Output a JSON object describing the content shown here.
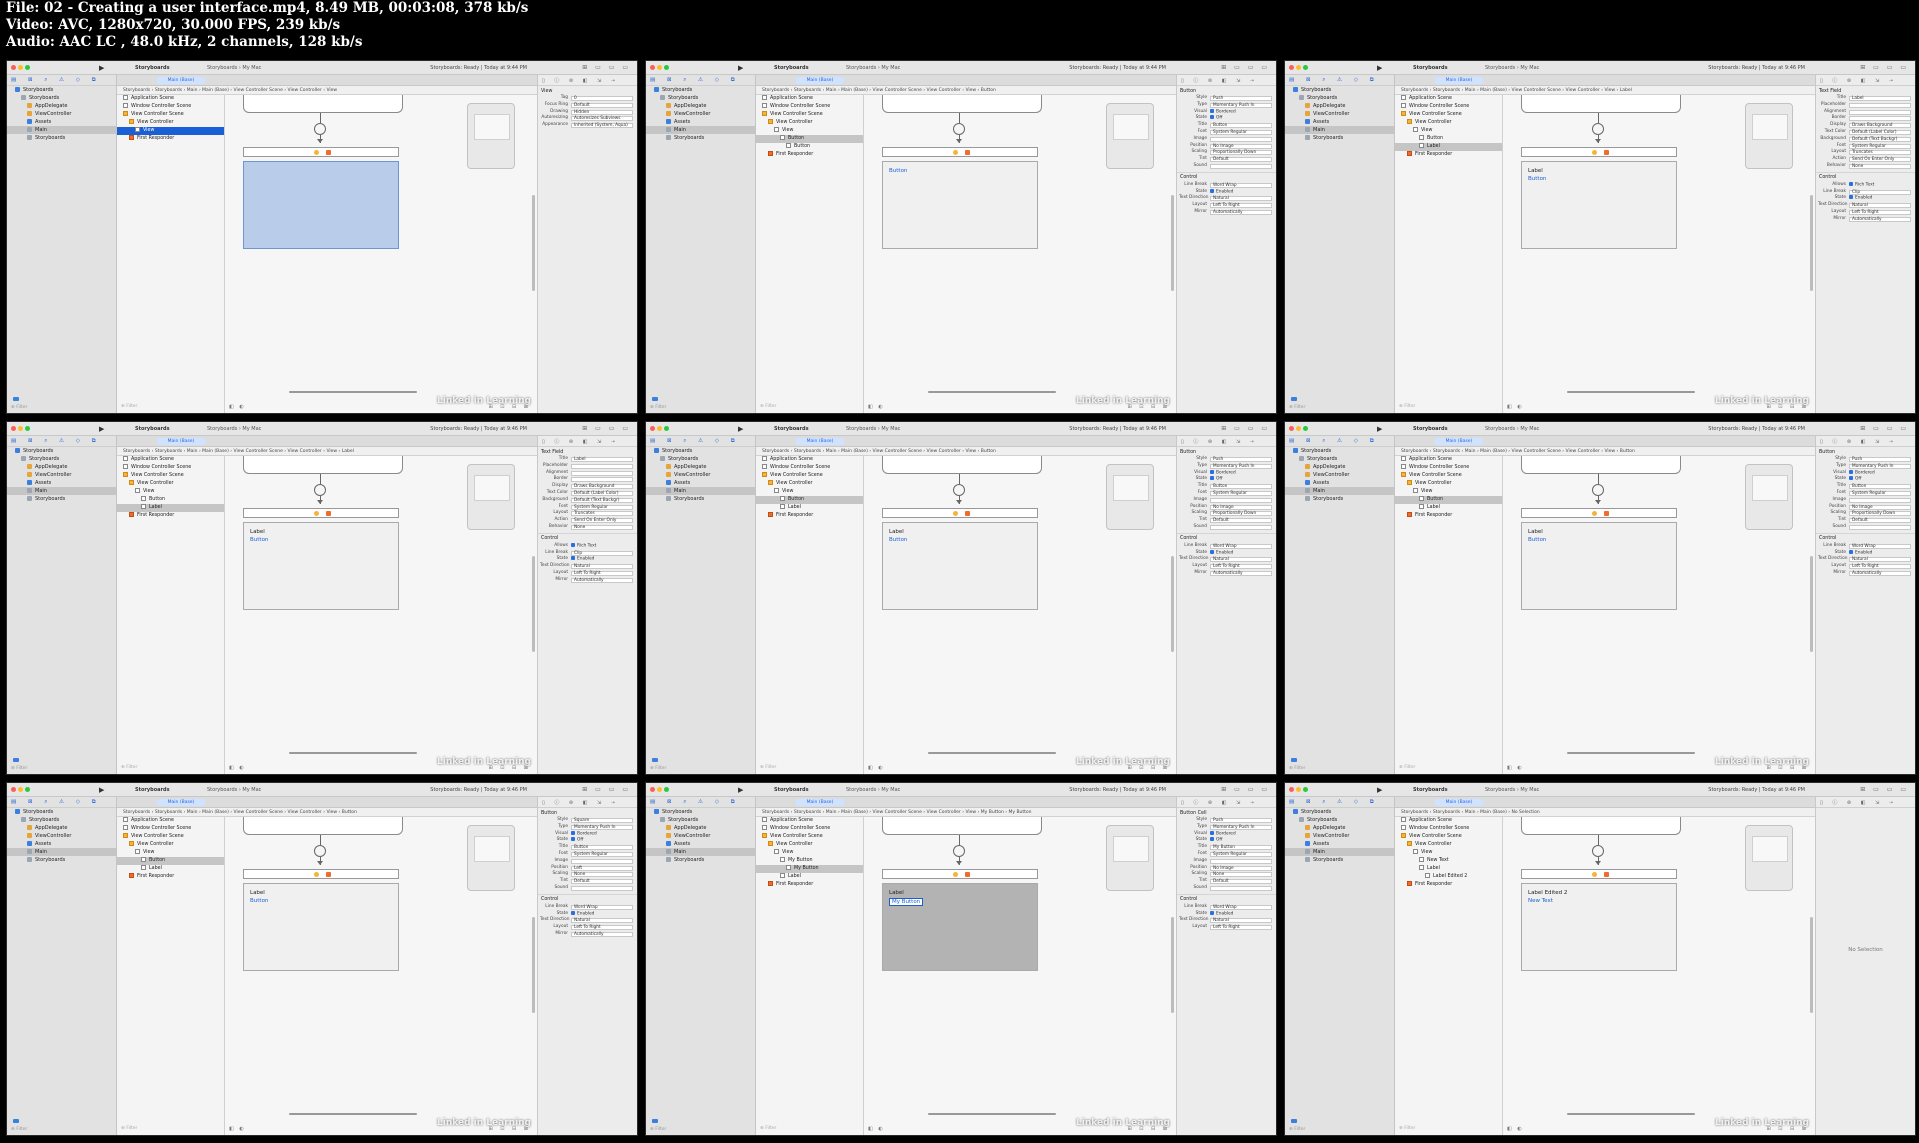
{
  "header": {
    "line1": "File: 02 - Creating a user interface.mp4, 8.49 MB, 00:03:08, 378 kb/s",
    "line2": "Video: AVC, 1280x720, 30.000 FPS, 239 kb/s",
    "line3": "Audio: AAC LC , 48.0 kHz, 2 channels, 128 kb/s"
  },
  "watermark": "Linked in Learning",
  "frames": [
    {
      "status": "Storyboards: Ready | Today at 9:44 PM",
      "jump": "Storyboards  ›  Storyboards  ›  Main  ›  Main (Base)  ›  View Controller Scene  ›  View Controller  ›  View",
      "scene": {
        "mode": "blue",
        "label": "",
        "button": ""
      },
      "inspector": {
        "title": "View",
        "rows": [
          [
            "Tag",
            "0"
          ],
          [
            "Focus Ring",
            "Default"
          ],
          [
            "Drawing",
            "Hidden"
          ],
          [
            "Autoresizing",
            "Autoresizes Subviews"
          ],
          [
            "Appearance",
            "Inherited (System, Aqua)"
          ]
        ]
      },
      "outline": [
        [
          "Application Scene",
          0,
          "sq",
          false
        ],
        [
          "Window Controller Scene",
          0,
          "sq",
          false
        ],
        [
          "View Controller Scene",
          0,
          "y",
          false
        ],
        [
          "View Controller",
          1,
          "y",
          false
        ],
        [
          "View",
          2,
          "sq",
          true
        ],
        [
          "First Responder",
          1,
          "o",
          false
        ]
      ]
    },
    {
      "status": "Storyboards: Ready | Today at 9:44 PM",
      "jump": "Storyboards  ›  Storyboards  ›  Main  ›  Main (Base)  ›  View Controller Scene  ›  View Controller  ›  View  ›  Button",
      "scene": {
        "mode": "plain",
        "label": "",
        "button": "Button"
      },
      "inspector": {
        "title": "Button",
        "rows": [
          [
            "Style",
            "Push"
          ],
          [
            "Type",
            "Momentary Push In"
          ],
          [
            "Visual",
            "Bordered"
          ],
          [
            "State",
            "Off"
          ],
          [
            "Title",
            "Button"
          ],
          [
            "Font",
            "System Regular"
          ],
          [
            "Image",
            ""
          ],
          [
            "Position",
            "No Image"
          ],
          [
            "Scaling",
            "Proportionally Down"
          ],
          [
            "Tint",
            "Default"
          ],
          [
            "Sound",
            ""
          ],
          [
            "Line Break",
            "Word Wrap"
          ],
          [
            "State",
            "Enabled"
          ],
          [
            "Text Direction",
            "Natural"
          ],
          [
            "Layout",
            "Left To Right"
          ],
          [
            "Mirror",
            "Automatically"
          ]
        ]
      },
      "outline": [
        [
          "Application Scene",
          0,
          "sq",
          false
        ],
        [
          "Window Controller Scene",
          0,
          "sq",
          false
        ],
        [
          "View Controller Scene",
          0,
          "y",
          false
        ],
        [
          "View Controller",
          1,
          "y",
          false
        ],
        [
          "View",
          2,
          "sq",
          false
        ],
        [
          "Button",
          3,
          "sq",
          true
        ],
        [
          "Button",
          4,
          "sq",
          false
        ],
        [
          "First Responder",
          1,
          "o",
          false
        ]
      ]
    },
    {
      "status": "Storyboards: Ready | Today at 9:46 PM",
      "jump": "Storyboards  ›  Storyboards  ›  Main  ›  Main (Base)  ›  View Controller Scene  ›  View Controller  ›  View  ›  Label",
      "scene": {
        "mode": "plain",
        "label": "Label",
        "button": "Button"
      },
      "inspector": {
        "title": "Text Field",
        "rows": [
          [
            "Title",
            "Label"
          ],
          [
            "Placeholder",
            ""
          ],
          [
            "Alignment",
            ""
          ],
          [
            "Border",
            ""
          ],
          [
            "Display",
            "Draws Background"
          ],
          [
            "Text Color",
            "Default (Label Color)"
          ],
          [
            "Background",
            "Default (Text Backgr)"
          ],
          [
            "Font",
            "System Regular"
          ],
          [
            "Layout",
            "Truncates"
          ],
          [
            "Action",
            "Send On Enter Only"
          ],
          [
            "Behavior",
            "None"
          ],
          [
            "Allows",
            "Rich Text"
          ],
          [
            "Line Break",
            "Clip"
          ],
          [
            "State",
            "Enabled"
          ],
          [
            "Text Direction",
            "Natural"
          ],
          [
            "Layout",
            "Left To Right"
          ],
          [
            "Mirror",
            "Automatically"
          ]
        ]
      },
      "outline": [
        [
          "Application Scene",
          0,
          "sq",
          false
        ],
        [
          "Window Controller Scene",
          0,
          "sq",
          false
        ],
        [
          "View Controller Scene",
          0,
          "y",
          false
        ],
        [
          "View Controller",
          1,
          "y",
          false
        ],
        [
          "View",
          2,
          "sq",
          false
        ],
        [
          "Button",
          3,
          "sq",
          false
        ],
        [
          "Label",
          3,
          "sq",
          true
        ],
        [
          "First Responder",
          1,
          "o",
          false
        ]
      ]
    },
    {
      "status": "Storyboards: Ready | Today at 9:46 PM",
      "jump": "Storyboards  ›  Storyboards  ›  Main  ›  Main (Base)  ›  View Controller Scene  ›  View Controller  ›  View  ›  Label",
      "scene": {
        "mode": "plain",
        "label": "Label",
        "button": "Button"
      },
      "inspector": {
        "title": "Text Field",
        "rows": [
          [
            "Title",
            "Label"
          ],
          [
            "Placeholder",
            ""
          ],
          [
            "Alignment",
            ""
          ],
          [
            "Border",
            ""
          ],
          [
            "Display",
            "Draws Background"
          ],
          [
            "Text Color",
            "Default (Label Color)"
          ],
          [
            "Background",
            "Default (Text Backgr)"
          ],
          [
            "Font",
            "System Regular"
          ],
          [
            "Layout",
            "Truncates"
          ],
          [
            "Action",
            "Send On Enter Only"
          ],
          [
            "Behavior",
            "None"
          ],
          [
            "Allows",
            "Rich Text"
          ],
          [
            "Line Break",
            "Clip"
          ],
          [
            "State",
            "Enabled"
          ],
          [
            "Text Direction",
            "Natural"
          ],
          [
            "Layout",
            "Left To Right"
          ],
          [
            "Mirror",
            "Automatically"
          ]
        ]
      },
      "outline": [
        [
          "Application Scene",
          0,
          "sq",
          false
        ],
        [
          "Window Controller Scene",
          0,
          "sq",
          false
        ],
        [
          "View Controller Scene",
          0,
          "y",
          false
        ],
        [
          "View Controller",
          1,
          "y",
          false
        ],
        [
          "View",
          2,
          "sq",
          false
        ],
        [
          "Button",
          3,
          "sq",
          false
        ],
        [
          "Label",
          3,
          "sq",
          true
        ],
        [
          "First Responder",
          1,
          "o",
          false
        ]
      ]
    },
    {
      "status": "Storyboards: Ready | Today at 9:46 PM",
      "jump": "Storyboards  ›  Storyboards  ›  Main  ›  Main (Base)  ›  View Controller Scene  ›  View Controller  ›  View  ›  Button",
      "scene": {
        "mode": "plain",
        "label": "Label",
        "button": "Button"
      },
      "inspector": {
        "title": "Button",
        "rows": [
          [
            "Style",
            "Push"
          ],
          [
            "Type",
            "Momentary Push In"
          ],
          [
            "Visual",
            "Bordered"
          ],
          [
            "State",
            "Off"
          ],
          [
            "Title",
            "Button"
          ],
          [
            "Font",
            "System Regular"
          ],
          [
            "Image",
            ""
          ],
          [
            "Position",
            "No Image"
          ],
          [
            "Scaling",
            "Proportionally Down"
          ],
          [
            "Tint",
            "Default"
          ],
          [
            "Sound",
            ""
          ],
          [
            "Line Break",
            "Word Wrap"
          ],
          [
            "State",
            "Enabled"
          ],
          [
            "Text Direction",
            "Natural"
          ],
          [
            "Layout",
            "Left To Right"
          ],
          [
            "Mirror",
            "Automatically"
          ]
        ]
      },
      "outline": [
        [
          "Application Scene",
          0,
          "sq",
          false
        ],
        [
          "Window Controller Scene",
          0,
          "sq",
          false
        ],
        [
          "View Controller Scene",
          0,
          "y",
          false
        ],
        [
          "View Controller",
          1,
          "y",
          false
        ],
        [
          "View",
          2,
          "sq",
          false
        ],
        [
          "Button",
          3,
          "sq",
          true
        ],
        [
          "Label",
          3,
          "sq",
          false
        ],
        [
          "First Responder",
          1,
          "o",
          false
        ]
      ]
    },
    {
      "status": "Storyboards: Ready | Today at 9:46 PM",
      "jump": "Storyboards  ›  Storyboards  ›  Main  ›  Main (Base)  ›  View Controller Scene  ›  View Controller  ›  View  ›  Button",
      "scene": {
        "mode": "plain",
        "label": "Label",
        "button": "Button"
      },
      "inspector": {
        "title": "Button",
        "rows": [
          [
            "Style",
            "Push"
          ],
          [
            "Type",
            "Momentary Push In"
          ],
          [
            "Visual",
            "Bordered"
          ],
          [
            "State",
            "Off"
          ],
          [
            "Title",
            "Button"
          ],
          [
            "Font",
            "System Regular"
          ],
          [
            "Image",
            ""
          ],
          [
            "Position",
            "No Image"
          ],
          [
            "Scaling",
            "Proportionally Down"
          ],
          [
            "Tint",
            "Default"
          ],
          [
            "Sound",
            ""
          ],
          [
            "Line Break",
            "Word Wrap"
          ],
          [
            "State",
            "Enabled"
          ],
          [
            "Text Direction",
            "Natural"
          ],
          [
            "Layout",
            "Left To Right"
          ],
          [
            "Mirror",
            "Automatically"
          ]
        ]
      },
      "outline": [
        [
          "Application Scene",
          0,
          "sq",
          false
        ],
        [
          "Window Controller Scene",
          0,
          "sq",
          false
        ],
        [
          "View Controller Scene",
          0,
          "y",
          false
        ],
        [
          "View Controller",
          1,
          "y",
          false
        ],
        [
          "View",
          2,
          "sq",
          false
        ],
        [
          "Button",
          3,
          "sq",
          true
        ],
        [
          "Label",
          3,
          "sq",
          false
        ],
        [
          "First Responder",
          1,
          "o",
          false
        ]
      ]
    },
    {
      "status": "Storyboards: Ready | Today at 9:46 PM",
      "jump": "Storyboards  ›  Storyboards  ›  Main  ›  Main (Base)  ›  View Controller Scene  ›  View Controller  ›  View  ›  Button",
      "scene": {
        "mode": "plain",
        "label": "Label",
        "button": "Button"
      },
      "inspector": {
        "title": "Button",
        "rows": [
          [
            "Style",
            "Square"
          ],
          [
            "Type",
            "Momentary Push In"
          ],
          [
            "Visual",
            "Bordered"
          ],
          [
            "State",
            "Off"
          ],
          [
            "Title",
            "Button"
          ],
          [
            "Font",
            "System Regular"
          ],
          [
            "Image",
            ""
          ],
          [
            "Position",
            "Left"
          ],
          [
            "Scaling",
            "None"
          ],
          [
            "Tint",
            "Default"
          ],
          [
            "Sound",
            ""
          ],
          [
            "Line Break",
            "Word Wrap"
          ],
          [
            "State",
            "Enabled"
          ],
          [
            "Text Direction",
            "Natural"
          ],
          [
            "Layout",
            "Left To Right"
          ],
          [
            "Mirror",
            "Automatically"
          ]
        ]
      },
      "outline": [
        [
          "Application Scene",
          0,
          "sq",
          false
        ],
        [
          "Window Controller Scene",
          0,
          "sq",
          false
        ],
        [
          "View Controller Scene",
          0,
          "y",
          false
        ],
        [
          "View Controller",
          1,
          "y",
          false
        ],
        [
          "View",
          2,
          "sq",
          false
        ],
        [
          "Button",
          3,
          "sq",
          true
        ],
        [
          "Label",
          3,
          "sq",
          false
        ],
        [
          "First Responder",
          1,
          "o",
          false
        ]
      ]
    },
    {
      "status": "Storyboards: Ready | Today at 9:46 PM",
      "jump": "Storyboards  ›  Storyboards  ›  Main  ›  Main (Base)  ›  View Controller Scene  ›  View Controller  ›  View  ›  My Button  ›  My Button",
      "scene": {
        "mode": "dark",
        "label": "Label",
        "button": "My Button"
      },
      "inspector": {
        "title": "Button Cell",
        "rows": [
          [
            "Style",
            "Push"
          ],
          [
            "Type",
            "Momentary Push In"
          ],
          [
            "Visual",
            "Bordered"
          ],
          [
            "State",
            "Off"
          ],
          [
            "Title",
            "My Button"
          ],
          [
            "Font",
            "System Regular"
          ],
          [
            "Image",
            ""
          ],
          [
            "Position",
            "No Image"
          ],
          [
            "Scaling",
            "None"
          ],
          [
            "Tint",
            "Default"
          ],
          [
            "Sound",
            ""
          ],
          [
            "Line Break",
            "Word Wrap"
          ],
          [
            "State",
            "Enabled"
          ],
          [
            "Text Direction",
            "Natural"
          ],
          [
            "Layout",
            "Left To Right"
          ]
        ]
      },
      "outline": [
        [
          "Application Scene",
          0,
          "sq",
          false
        ],
        [
          "Window Controller Scene",
          0,
          "sq",
          false
        ],
        [
          "View Controller Scene",
          0,
          "y",
          false
        ],
        [
          "View Controller",
          1,
          "y",
          false
        ],
        [
          "View",
          2,
          "sq",
          false
        ],
        [
          "My Button",
          3,
          "sq",
          false
        ],
        [
          "My Button",
          4,
          "sq",
          true
        ],
        [
          "Label",
          3,
          "sq",
          false
        ],
        [
          "First Responder",
          1,
          "o",
          false
        ]
      ]
    },
    {
      "status": "Storyboards: Ready | Today at 9:46 PM",
      "jump": "Storyboards  ›  Storyboards  ›  Main  ›  Main (Base)  ›  No Selection",
      "scene": {
        "mode": "plain",
        "label": "Label Edited 2",
        "button": "New Text"
      },
      "inspector": {
        "title": "",
        "rows": [],
        "no_selection": "No Selection"
      },
      "outline": [
        [
          "Application Scene",
          0,
          "sq",
          false
        ],
        [
          "Window Controller Scene",
          0,
          "sq",
          false
        ],
        [
          "View Controller Scene",
          0,
          "y",
          false
        ],
        [
          "View Controller",
          1,
          "y",
          false
        ],
        [
          "View",
          2,
          "sq",
          false
        ],
        [
          "New Text",
          3,
          "sq",
          false
        ],
        [
          "Label",
          3,
          "sq",
          false
        ],
        [
          "Label Edited 2",
          4,
          "sq",
          false
        ],
        [
          "First Responder",
          1,
          "o",
          false
        ]
      ]
    }
  ],
  "nav": [
    [
      "Storyboards",
      0,
      "b"
    ],
    [
      "Storyboards",
      1,
      "g"
    ],
    [
      "AppDelegate",
      2,
      "y"
    ],
    [
      "ViewController",
      2,
      "y"
    ],
    [
      "Assets",
      2,
      "b"
    ],
    [
      "Main",
      2,
      "g"
    ],
    [
      "Storyboards",
      2,
      "g"
    ]
  ],
  "toolbar": {
    "scheme": "Storyboards",
    "destination": "Storyboards  ›  My Mac",
    "tab": "Main (Base)"
  },
  "canvas_footer": "View as: Dark"
}
